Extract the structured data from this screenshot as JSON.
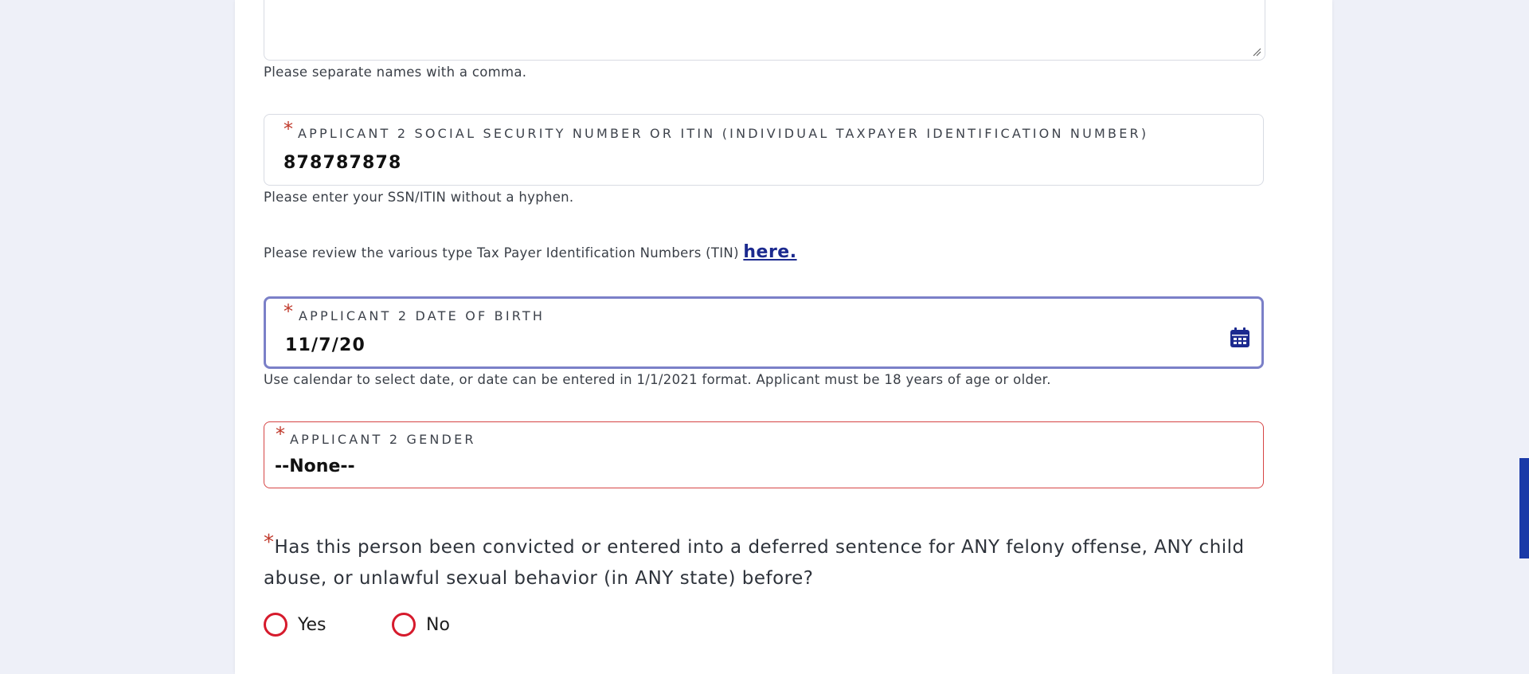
{
  "textarea_help": "Please separate names with a comma.",
  "ssn_field": {
    "label": "APPLICANT 2 SOCIAL SECURITY NUMBER OR ITIN (INDIVIDUAL TAXPAYER IDENTIFICATION NUMBER)",
    "value": "878787878",
    "required_mark": "*",
    "help": "Please enter your SSN/ITIN without a hyphen."
  },
  "tin_review": {
    "text": "Please review the various type Tax Payer Identification Numbers (TIN)",
    "link_label": "here."
  },
  "dob_field": {
    "label": "APPLICANT 2 DATE OF BIRTH",
    "value": "11/7/20",
    "required_mark": "*",
    "icon": "calendar-icon",
    "help": "Use calendar to select date, or date can be entered in 1/1/2021 format. Applicant must be 18 years of age or older."
  },
  "gender_field": {
    "label": "APPLICANT 2 GENDER",
    "value": "--None--",
    "required_mark": "*"
  },
  "felony_question": {
    "required_mark": "*",
    "text": "Has this person been convicted or entered into a deferred sentence for ANY felony offense, ANY child abuse, or unlawful sexual behavior (in ANY state) before?",
    "options": [
      {
        "label": "Yes"
      },
      {
        "label": "No"
      }
    ]
  },
  "colors": {
    "background": "#eef0f8",
    "required": "#c0392b",
    "radio": "#d61a2c",
    "link": "#1c2a8f",
    "focus_border": "#7b80c8",
    "error_border": "#d64545",
    "scroll_thumb": "#1a3aa8"
  }
}
